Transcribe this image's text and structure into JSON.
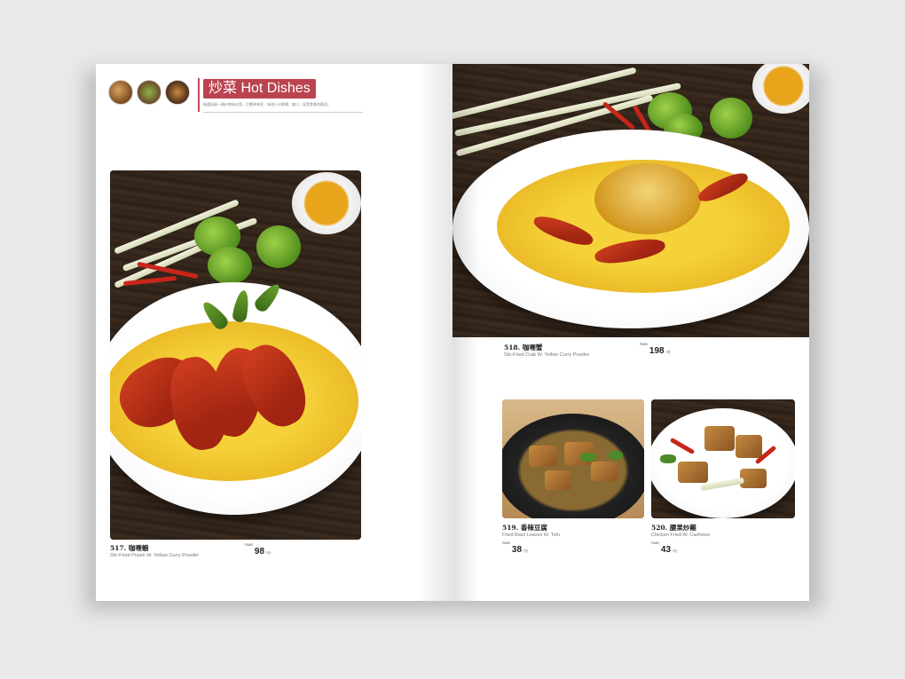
{
  "header": {
    "title": "炒菜 Hot Dishes",
    "description": "精選彩椒一鍋炒辣味炒菜，打數神來家，味道十分鮮嫩，爽口，深受食客的歡迎。"
  },
  "dishes": [
    {
      "id": "517",
      "title": "517. 咖喱蝦",
      "subtitle": "Stir-Fried Prawn W. Yellow Curry Powder",
      "currency": "RMB",
      "price": "98",
      "unit": "/份"
    },
    {
      "id": "518",
      "title": "518. 咖喱蟹",
      "subtitle": "Stir-Fried Crab W. Yellow Curry Powder",
      "currency": "RMB",
      "price": "198",
      "unit": "/份"
    },
    {
      "id": "519",
      "title": "519. 香辣豆腐",
      "subtitle": "Fried Basil Leaves W. Tofu",
      "currency": "RMB",
      "price": "38",
      "unit": "/份"
    },
    {
      "id": "520",
      "title": "520. 腰果炒雞",
      "subtitle": "Chicken Fried W. Cashews",
      "currency": "RMB",
      "price": "43",
      "unit": "/份"
    }
  ]
}
